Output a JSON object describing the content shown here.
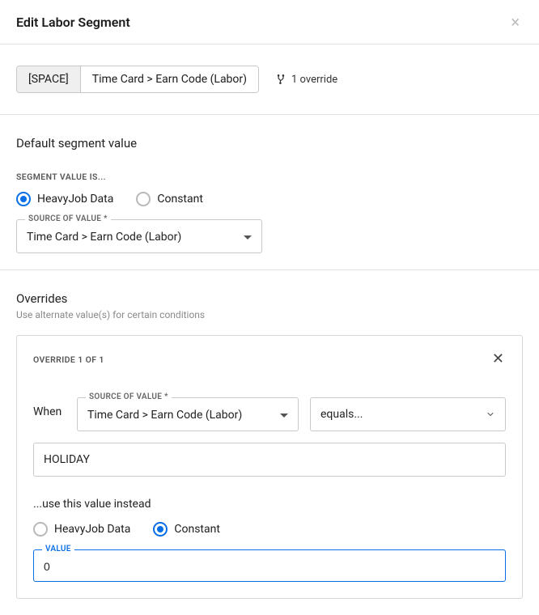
{
  "header": {
    "title": "Edit Labor Segment"
  },
  "topbar": {
    "space_label": "[SPACE]",
    "source_label": "Time Card > Earn Code (Labor)",
    "override_count": "1 override"
  },
  "default_segment": {
    "title": "Default segment value",
    "segment_value_is_label": "Segment value is...",
    "radio_options": {
      "heavyjob": "HeavyJob Data",
      "constant": "Constant"
    },
    "radio_selected": "heavyjob",
    "source_of_value_label": "Source of value *",
    "source_of_value": "Time Card > Earn Code (Labor)"
  },
  "overrides": {
    "title": "Overrides",
    "subtitle": "Use alternate value(s) for certain conditions",
    "card": {
      "header": "Override 1 of 1",
      "when_label": "When",
      "source_of_value_label": "Source of value *",
      "source_of_value": "Time Card > Earn Code (Labor)",
      "operator": "equals...",
      "condition_value": "HOLIDAY",
      "use_instead_label": "...use this value instead",
      "radio_options": {
        "heavyjob": "HeavyJob Data",
        "constant": "Constant"
      },
      "radio_selected": "constant",
      "value_label": "Value",
      "value": "0"
    }
  }
}
